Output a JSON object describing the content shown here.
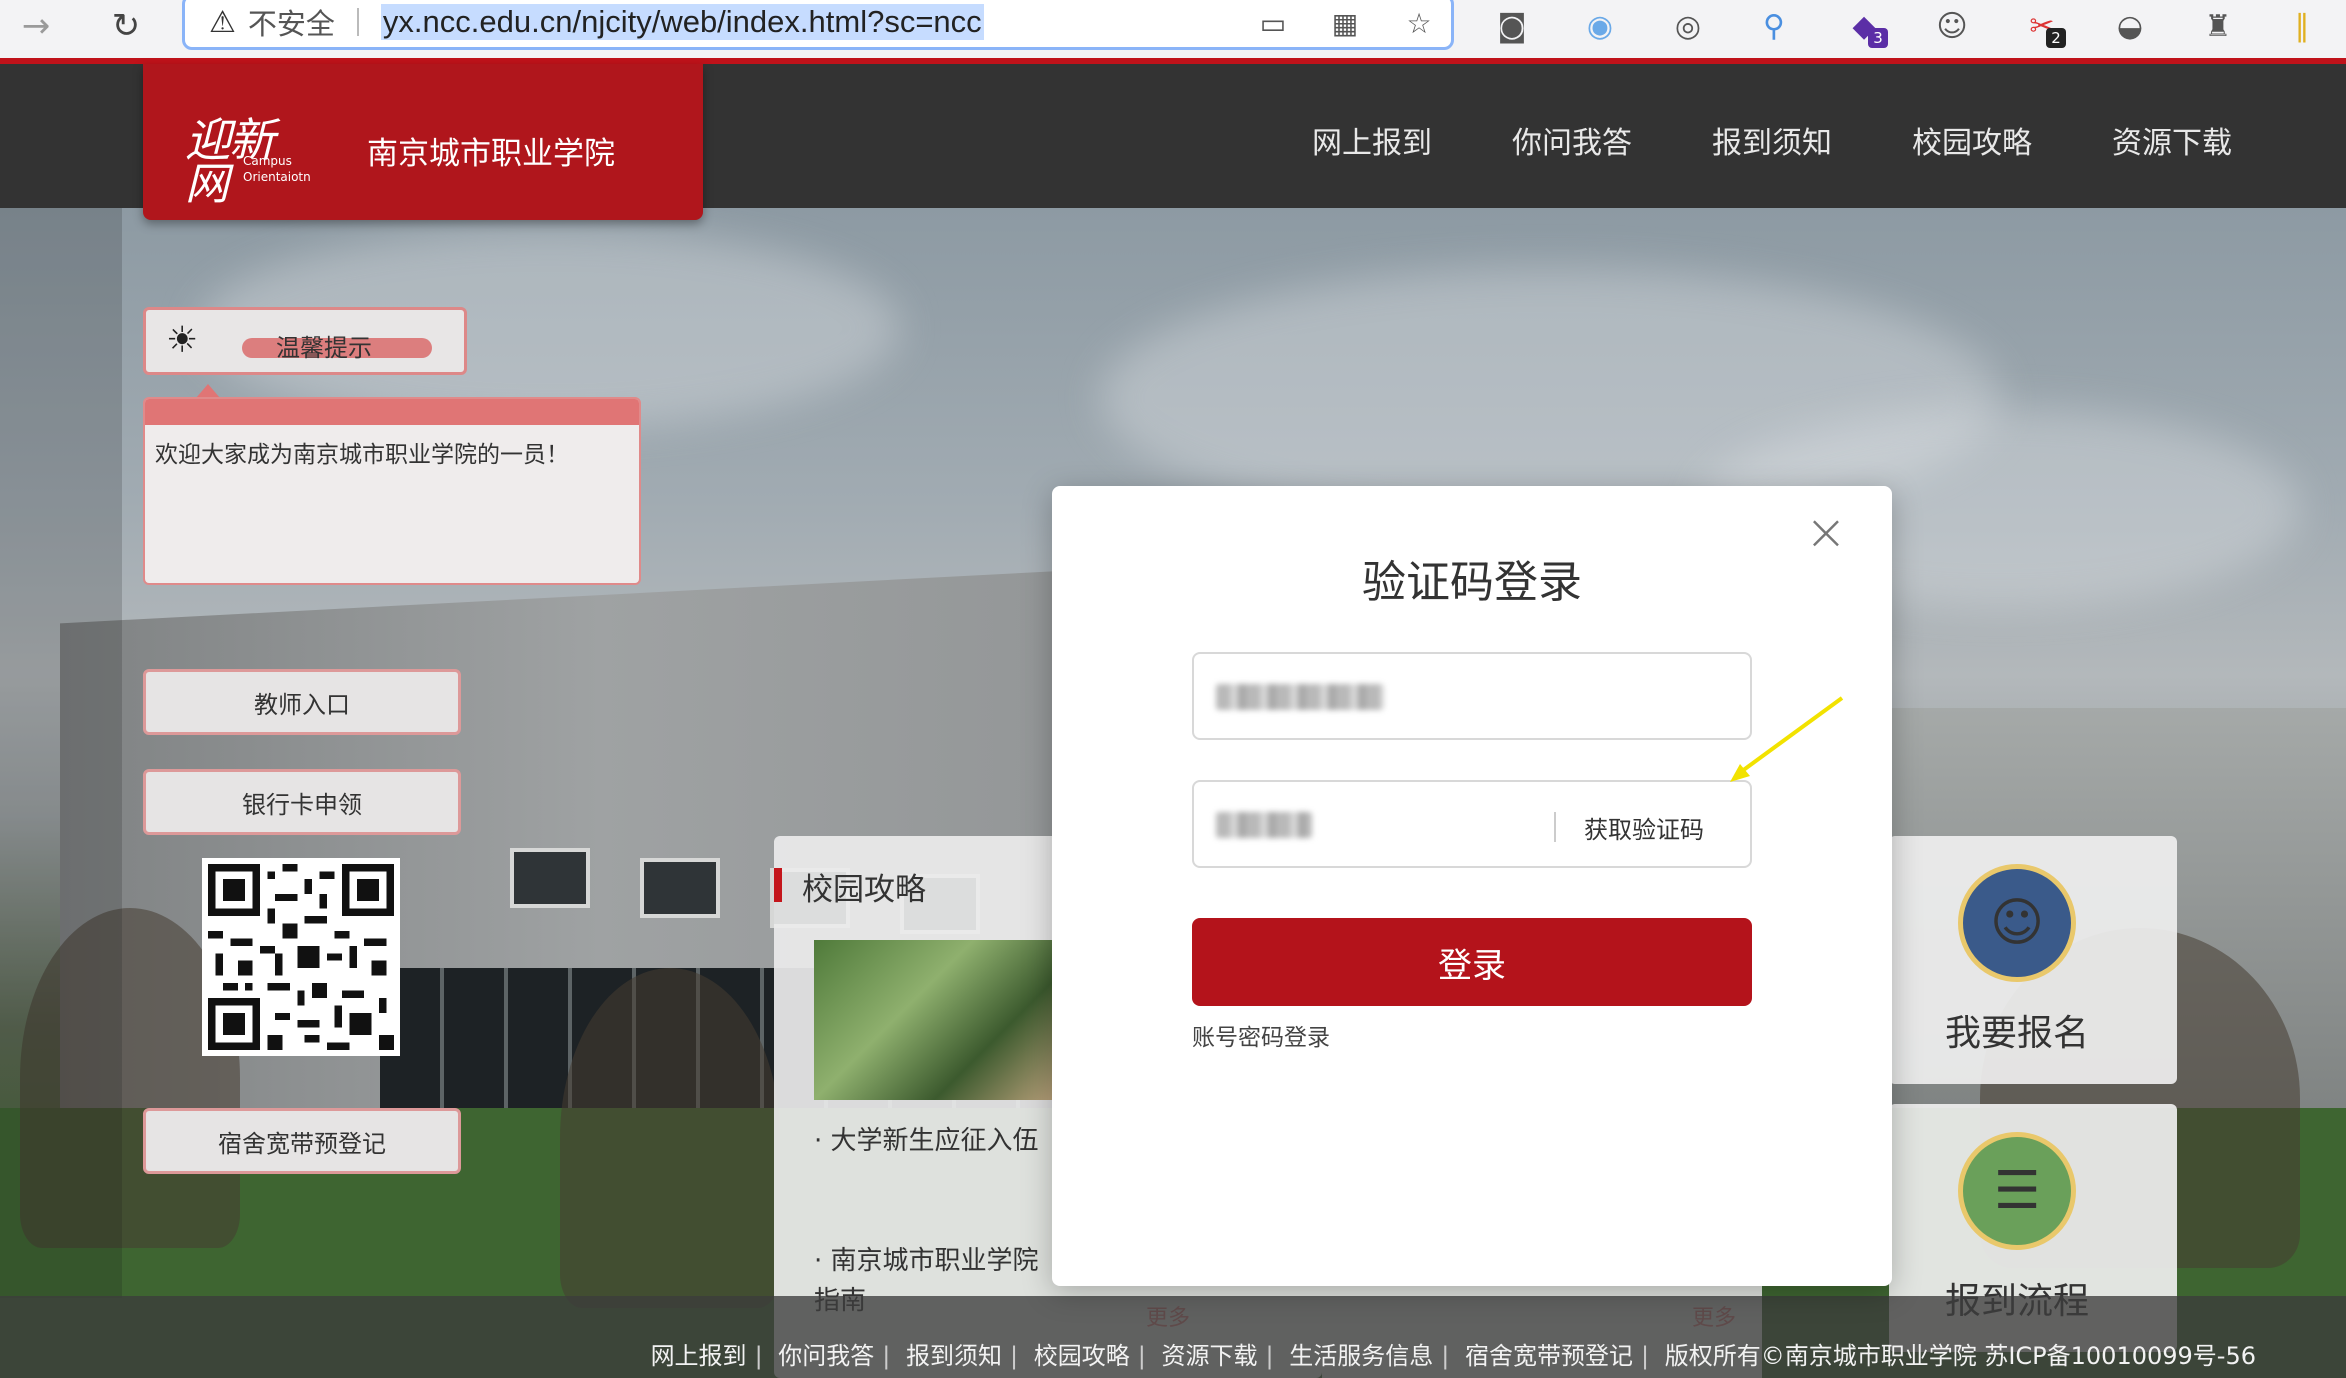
{
  "browser": {
    "security_label": "不安全",
    "url": "yx.ncc.edu.cn/njcity/web/index.html?sc=ncc",
    "ext_badges": [
      "3",
      "2"
    ]
  },
  "site": {
    "logo_text_line1": "迎新",
    "logo_text_line2": "网",
    "logo_caption1": "Campus",
    "logo_caption2": "Orientaiotn",
    "school_name": "南京城市职业学院",
    "nav": [
      "网上报到",
      "你问我答",
      "报到须知",
      "校园攻略",
      "资源下载"
    ]
  },
  "sidebar": {
    "tip_label": "温馨提示",
    "tip_message": "欢迎大家成为南京城市职业学院的一员！",
    "buttons": {
      "teacher": "教师入口",
      "bank_card": "银行卡申领",
      "broadband": "宿舍宽带预登记"
    }
  },
  "guide_card": {
    "title": "校园攻略",
    "items": [
      "· 大学新生应征入伍",
      "· 南京城市职业学院",
      "指南"
    ],
    "more": "更多"
  },
  "news_card": {
    "more": "更多"
  },
  "right_cards": {
    "enroll": "我要报名",
    "process": "报到流程"
  },
  "modal": {
    "title": "验证码登录",
    "get_code": "获取验证码",
    "login": "登录",
    "alt_login": "账号密码登录"
  },
  "footer": {
    "links": [
      "网上报到",
      "你问我答",
      "报到须知",
      "校园攻略",
      "资源下载",
      "生活服务信息",
      "宿舍宽带预登记"
    ],
    "copyright": "版权所有©南京城市职业学院 苏ICP备10010099号-56"
  },
  "colors": {
    "brand_red": "#b4131b",
    "header_bg": "#333333",
    "annotation_arrow": "#f2e200"
  }
}
